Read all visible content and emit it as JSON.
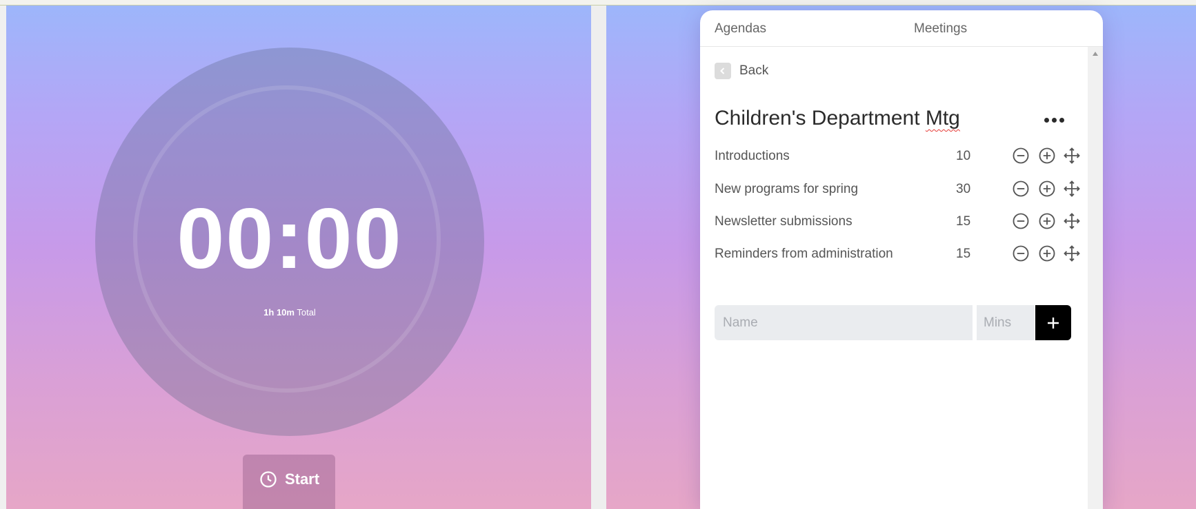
{
  "timer": {
    "display": "00:00",
    "total_value": "1h 10m",
    "total_label": "Total",
    "start_label": "Start"
  },
  "tabs": [
    {
      "label": "Agendas"
    },
    {
      "label": "Meetings"
    }
  ],
  "back_label": "Back",
  "agenda": {
    "title_main": "Children's Department ",
    "title_flagged": "Mtg",
    "items": [
      {
        "name": "Introductions",
        "minutes": "10"
      },
      {
        "name": "New programs for spring",
        "minutes": "30"
      },
      {
        "name": "Newsletter submissions",
        "minutes": "15"
      },
      {
        "name": "Reminders from administration",
        "minutes": "15"
      }
    ]
  },
  "add_form": {
    "name_placeholder": "Name",
    "mins_placeholder": "Mins"
  },
  "icons": {
    "start": "clock-icon",
    "back": "chevron-left-icon",
    "more": "more-horizontal-icon",
    "decrease": "minus-circle-icon",
    "increase": "plus-circle-icon",
    "reorder": "move-icon",
    "add": "plus-icon"
  },
  "colors": {
    "gradient_top": "#9db6fb",
    "gradient_bottom": "#e6a6c7",
    "add_button": "#000000",
    "spellcheck": "#e53935"
  }
}
